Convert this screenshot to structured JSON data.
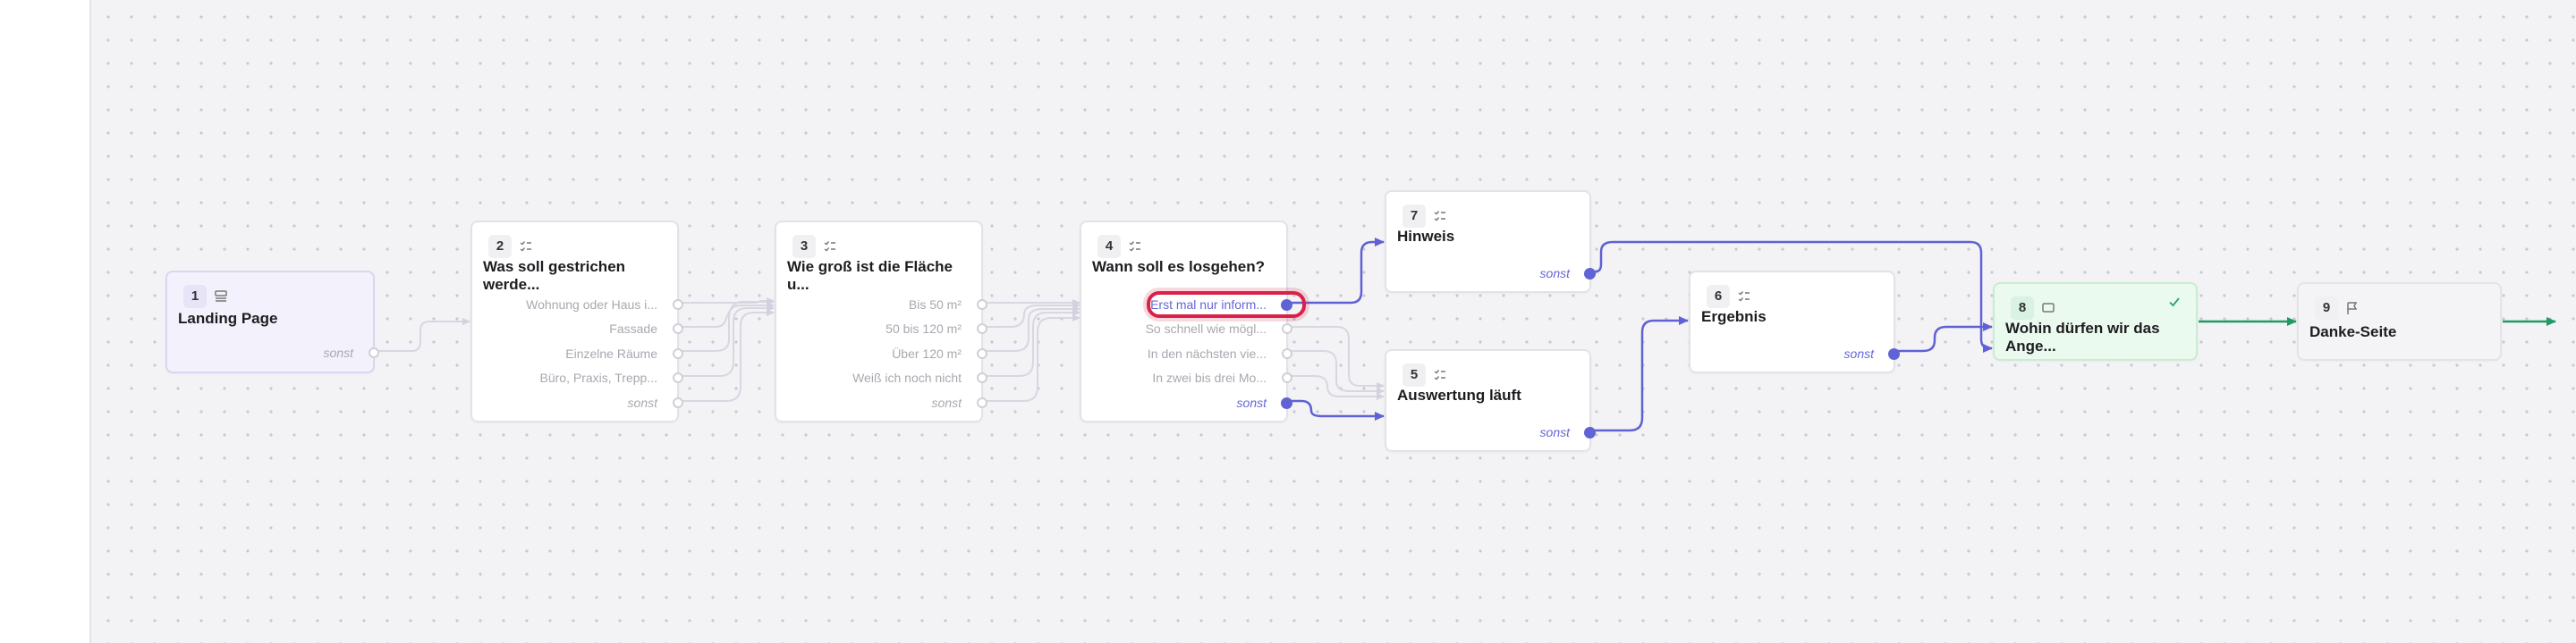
{
  "colors": {
    "accent": "#6063d6",
    "success": "#1f9a63",
    "muted_edge": "#d7d7e2",
    "highlight": "#d8214a"
  },
  "nodes": {
    "n1": {
      "number": "1",
      "icon": "layout-icon",
      "title": "Landing Page",
      "answers": [
        {
          "label": "sonst"
        }
      ]
    },
    "n2": {
      "number": "2",
      "icon": "list-icon",
      "title": "Was soll gestrichen werde...",
      "answers": [
        {
          "label": "Wohnung oder Haus i..."
        },
        {
          "label": "Fassade"
        },
        {
          "label": "Einzelne Räume"
        },
        {
          "label": "Büro, Praxis, Trepp..."
        },
        {
          "label": "sonst"
        }
      ]
    },
    "n3": {
      "number": "3",
      "icon": "list-icon",
      "title": "Wie groß ist die Fläche u...",
      "answers": [
        {
          "label": "Bis 50 m²"
        },
        {
          "label": "50 bis 120 m²"
        },
        {
          "label": "Über 120 m²"
        },
        {
          "label": "Weiß ich noch nicht"
        },
        {
          "label": "sonst"
        }
      ]
    },
    "n4": {
      "number": "4",
      "icon": "list-icon",
      "title": "Wann soll es losgehen?",
      "answers": [
        {
          "label": "Erst mal nur inform..."
        },
        {
          "label": "So schnell wie mögl..."
        },
        {
          "label": "In den nächsten vie..."
        },
        {
          "label": "In zwei bis drei Mo..."
        },
        {
          "label": "sonst"
        }
      ]
    },
    "n7": {
      "number": "7",
      "icon": "list-icon",
      "title": "Hinweis",
      "answers": [
        {
          "label": "sonst"
        }
      ]
    },
    "n5": {
      "number": "5",
      "icon": "list-icon",
      "title": "Auswertung läuft",
      "answers": [
        {
          "label": "sonst"
        }
      ]
    },
    "n6": {
      "number": "6",
      "icon": "list-icon",
      "title": "Ergebnis",
      "answers": [
        {
          "label": "sonst"
        }
      ]
    },
    "n8": {
      "number": "8",
      "icon": "message-icon",
      "title": "Wohin dürfen wir das Ange...",
      "status": "check-icon"
    },
    "n9": {
      "number": "9",
      "icon": "flag-icon",
      "title": "Danke-Seite"
    }
  }
}
